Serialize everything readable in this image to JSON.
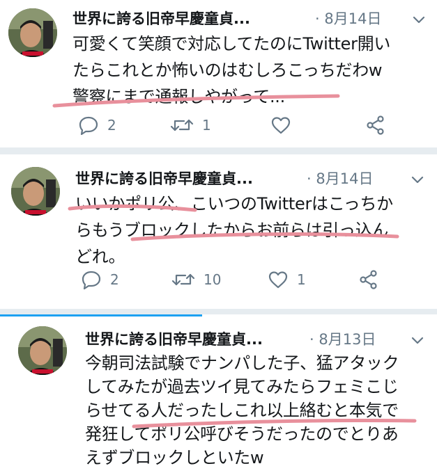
{
  "tweets": [
    {
      "display_name": "世界に誇る旧帝早慶童貞...",
      "date_sep": "·",
      "date": "8月14日",
      "lines": [
        "可愛くて笑顔で対応してたのにTwitter開い",
        "たらこれとか怖いのはむしろこっちだわw",
        "警察にまで通報しやがって..."
      ],
      "reply_count": "2",
      "retweet_count": "1",
      "like_count": ""
    },
    {
      "display_name": "世界に誇る旧帝早慶童貞...",
      "date_sep": "·",
      "date": "8月14日",
      "lines": [
        "いいかポリ公、こいつのTwitterはこっちか",
        "らもうブロックしたからお前らは引っ込ん",
        "どれ。"
      ],
      "reply_count": "2",
      "retweet_count": "10",
      "like_count": "1"
    },
    {
      "display_name": "世界に誇る旧帝早慶童貞...",
      "date_sep": "·",
      "date": "8月13日",
      "lines": [
        "今朝司法試験でナンパした子、猛アタック",
        "してみたが過去ツイ見てみたらフェミこじ",
        "らせてる人だったしこれ以上絡むと本気で",
        "発狂してポリ公呼びそうだったのでとりあ",
        "えずブロックしといたw"
      ]
    }
  ],
  "colors": {
    "highlight": "#e8909c",
    "meta": "#657786",
    "divider": "#e6ecf0",
    "accent": "#1da1f2"
  }
}
